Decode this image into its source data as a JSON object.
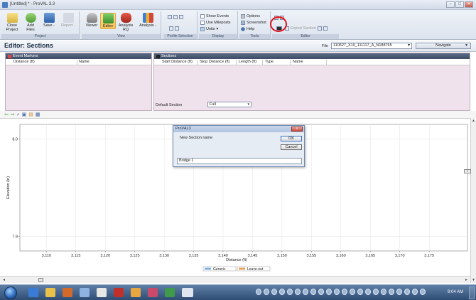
{
  "window": {
    "title": "[Untitled] * - ProVAL 3.3",
    "controls": [
      "–",
      "□",
      "✕"
    ]
  },
  "ribbon": {
    "project": {
      "label": "Project",
      "close_label": "Close Project",
      "add_files_label": "Add Files",
      "save_label": "Save -",
      "report_label": "Report -"
    },
    "view": {
      "label": "View",
      "viewer_label": "Viewer",
      "editor_label": "Editor",
      "analysis_rq_label": "Analysis RQ",
      "analysis_label": "Analysis -"
    },
    "profile_selection": {
      "label": "Profile Selection"
    },
    "display": {
      "label": "Display",
      "show_events": "Show Events",
      "use_mileposts": "Use Mileposts",
      "units": "Units"
    },
    "tools": {
      "label": "Tools",
      "options": "Options",
      "screenshot": "Screenshot",
      "help": "Help"
    },
    "editor": {
      "label": "Editor",
      "export_section": "Export Section"
    }
  },
  "editor_header": {
    "title": "Editor: Sections",
    "file_label": "File",
    "file_value": "110527_X10_111117_A_N188765",
    "navigate_label": "Navigate"
  },
  "event_markers": {
    "title": "Event Markers",
    "columns": [
      "Distance (ft)",
      "Name"
    ]
  },
  "sections": {
    "title": "Sections",
    "columns": [
      "Start Distance (ft)",
      "Stop Distance (ft)",
      "Length (ft)",
      "Type",
      "Name"
    ],
    "default_section_label": "Default Section",
    "default_section_value": "Full"
  },
  "chart_data": {
    "type": "line",
    "title": "",
    "xlabel": "Distance (ft)",
    "ylabel": "Elevation (in)",
    "x_ticks": [
      "3,110",
      "3,115",
      "3,120",
      "3,125",
      "3,130",
      "3,135",
      "3,140",
      "3,145",
      "3,150",
      "3,155",
      "3,160",
      "3,165",
      "3,170",
      "3,175"
    ],
    "y_ticks": [
      "8.0",
      "7.9"
    ],
    "xlim": [
      3105.5,
      3181.5
    ],
    "ylim": [
      7.885,
      8.015
    ],
    "grid": true,
    "legend": [
      "Generic",
      "Leave-out"
    ],
    "legend_colors": [
      "#7fb2e0",
      "#e8a45a"
    ],
    "legend_position": "bottom-center",
    "series": []
  },
  "dialog": {
    "title": "ProVAL3",
    "prompt": "New Section name",
    "ok_label": "OK",
    "cancel_label": "Cancel",
    "input_value": "Bridge 1"
  },
  "taskbar": {
    "clock": "9:04 AM"
  },
  "colors": {
    "highlight_circle": "#e0141c",
    "panel_bg": "#efe2ec",
    "panel_header": "#4a5874"
  }
}
